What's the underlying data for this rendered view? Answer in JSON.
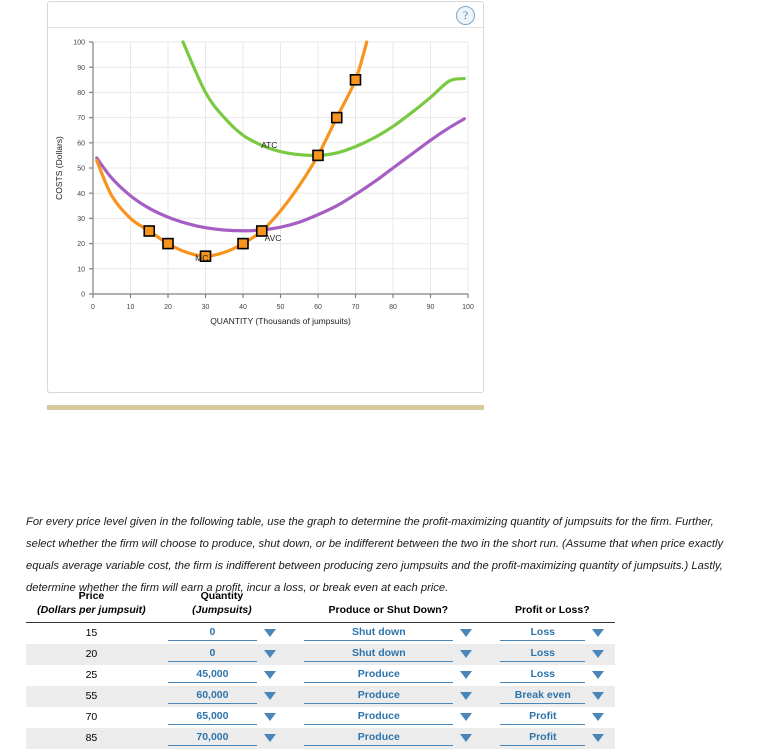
{
  "graph_panel": {
    "help_icon_label": "?",
    "help_icon_name": "question-mark-icon"
  },
  "instructions": {
    "text": "For every price level given in the following table, use the graph to determine the profit-maximizing quantity of jumpsuits for the firm. Further, select whether the firm will choose to produce, shut down, or be indifferent between the two in the short run. (Assume that when price exactly equals average variable cost, the firm is indifferent between producing zero jumpsuits and the profit-maximizing quantity of jumpsuits.) Lastly, determine whether the firm will earn a profit, incur a loss, or break even at each price."
  },
  "table": {
    "headers": [
      {
        "main": "Price",
        "sub": "(Dollars per jumpsuit)"
      },
      {
        "main": "Quantity",
        "sub": "(Jumpsuits)"
      },
      {
        "main": "",
        "sub": "Produce or Shut Down?"
      },
      {
        "main": "",
        "sub": "Profit or Loss?"
      }
    ],
    "rows": [
      {
        "price": "15",
        "quantity": "0",
        "decision": "Shut down",
        "outcome": "Loss"
      },
      {
        "price": "20",
        "quantity": "0",
        "decision": "Shut down",
        "outcome": "Loss"
      },
      {
        "price": "25",
        "quantity": "45,000",
        "decision": "Produce",
        "outcome": "Loss"
      },
      {
        "price": "55",
        "quantity": "60,000",
        "decision": "Produce",
        "outcome": "Break even"
      },
      {
        "price": "70",
        "quantity": "65,000",
        "decision": "Produce",
        "outcome": "Profit"
      },
      {
        "price": "85",
        "quantity": "70,000",
        "decision": "Produce",
        "outcome": "Profit"
      }
    ]
  },
  "colors": {
    "mc": "#f7941e",
    "atc": "#7ac943",
    "avc": "#a55fc4",
    "marker_outline": "#000000",
    "dropdown_blue": "#2e74aa",
    "divider": "#d6c99a",
    "grid": "#e8e8e8",
    "axis": "#808080"
  },
  "chart_data": {
    "type": "line",
    "title": "",
    "xlabel": "QUANTITY (Thousands of jumpsuits)",
    "ylabel": "COSTS (Dollars)",
    "xlim": [
      0,
      100
    ],
    "ylim": [
      0,
      100
    ],
    "xticks": [
      0,
      10,
      20,
      30,
      40,
      50,
      60,
      70,
      80,
      90,
      100
    ],
    "yticks": [
      0,
      10,
      20,
      30,
      40,
      50,
      60,
      70,
      80,
      90,
      100
    ],
    "grid": true,
    "legend": "inline-labels",
    "series": [
      {
        "name": "MC",
        "label": "MC",
        "color": "#f7941e",
        "label_x": 29,
        "label_y": 13,
        "markers": [
          {
            "x": 15,
            "y": 25
          },
          {
            "x": 20,
            "y": 20
          },
          {
            "x": 30,
            "y": 15
          },
          {
            "x": 40,
            "y": 20
          },
          {
            "x": 45,
            "y": 25
          },
          {
            "x": 60,
            "y": 55
          },
          {
            "x": 65,
            "y": 70
          },
          {
            "x": 70,
            "y": 85
          }
        ],
        "points": [
          {
            "x": 1,
            "y": 53
          },
          {
            "x": 5,
            "y": 39
          },
          {
            "x": 10,
            "y": 30
          },
          {
            "x": 15,
            "y": 25
          },
          {
            "x": 20,
            "y": 20
          },
          {
            "x": 25,
            "y": 16.5
          },
          {
            "x": 30,
            "y": 15
          },
          {
            "x": 35,
            "y": 16.5
          },
          {
            "x": 40,
            "y": 20
          },
          {
            "x": 45,
            "y": 25
          },
          {
            "x": 50,
            "y": 33
          },
          {
            "x": 55,
            "y": 43
          },
          {
            "x": 60,
            "y": 55
          },
          {
            "x": 65,
            "y": 70
          },
          {
            "x": 70,
            "y": 85
          },
          {
            "x": 73,
            "y": 100
          }
        ]
      },
      {
        "name": "ATC",
        "label": "ATC",
        "color": "#7ac943",
        "label_x": 47,
        "label_y": 58,
        "points": [
          {
            "x": 24,
            "y": 100
          },
          {
            "x": 30,
            "y": 80
          },
          {
            "x": 35,
            "y": 70
          },
          {
            "x": 40,
            "y": 63
          },
          {
            "x": 45,
            "y": 59
          },
          {
            "x": 50,
            "y": 56.5
          },
          {
            "x": 55,
            "y": 55.3
          },
          {
            "x": 60,
            "y": 55
          },
          {
            "x": 65,
            "y": 56
          },
          {
            "x": 70,
            "y": 58.5
          },
          {
            "x": 75,
            "y": 62
          },
          {
            "x": 80,
            "y": 66.5
          },
          {
            "x": 85,
            "y": 72
          },
          {
            "x": 90,
            "y": 78
          },
          {
            "x": 95,
            "y": 84.5
          },
          {
            "x": 99,
            "y": 85.5
          }
        ]
      },
      {
        "name": "AVC",
        "label": "AVC",
        "color": "#a55fc4",
        "label_x": 48,
        "label_y": 21,
        "points": [
          {
            "x": 1,
            "y": 54
          },
          {
            "x": 5,
            "y": 46
          },
          {
            "x": 10,
            "y": 39
          },
          {
            "x": 15,
            "y": 34
          },
          {
            "x": 20,
            "y": 30.5
          },
          {
            "x": 25,
            "y": 28
          },
          {
            "x": 30,
            "y": 26.3
          },
          {
            "x": 35,
            "y": 25.4
          },
          {
            "x": 40,
            "y": 25.1
          },
          {
            "x": 45,
            "y": 25.4
          },
          {
            "x": 50,
            "y": 26.5
          },
          {
            "x": 55,
            "y": 28.5
          },
          {
            "x": 60,
            "y": 31.5
          },
          {
            "x": 65,
            "y": 35
          },
          {
            "x": 70,
            "y": 39.5
          },
          {
            "x": 75,
            "y": 44.5
          },
          {
            "x": 80,
            "y": 50
          },
          {
            "x": 85,
            "y": 55.5
          },
          {
            "x": 90,
            "y": 61
          },
          {
            "x": 95,
            "y": 66
          },
          {
            "x": 99,
            "y": 69.5
          }
        ]
      }
    ]
  }
}
